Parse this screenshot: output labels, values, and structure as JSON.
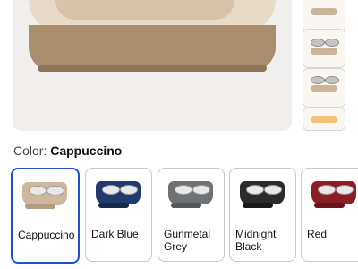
{
  "product": {
    "color_prefix": "Color: ",
    "selected_color": "Cappuccino"
  },
  "swatches": [
    {
      "label": "Cappuccino",
      "color": "#cdb89b",
      "selected": true
    },
    {
      "label": "Dark Blue",
      "color": "#1f3a6b",
      "selected": false
    },
    {
      "label": "Gunmetal\nGrey",
      "color": "#6f7275",
      "selected": false
    },
    {
      "label": "Midnight\nBlack",
      "color": "#2b2b2b",
      "selected": false
    },
    {
      "label": "Red",
      "color": "#8b1e24",
      "selected": false
    }
  ],
  "colors": {
    "selected_border": "#1f4ed8",
    "image_bg": "#f0efee"
  }
}
